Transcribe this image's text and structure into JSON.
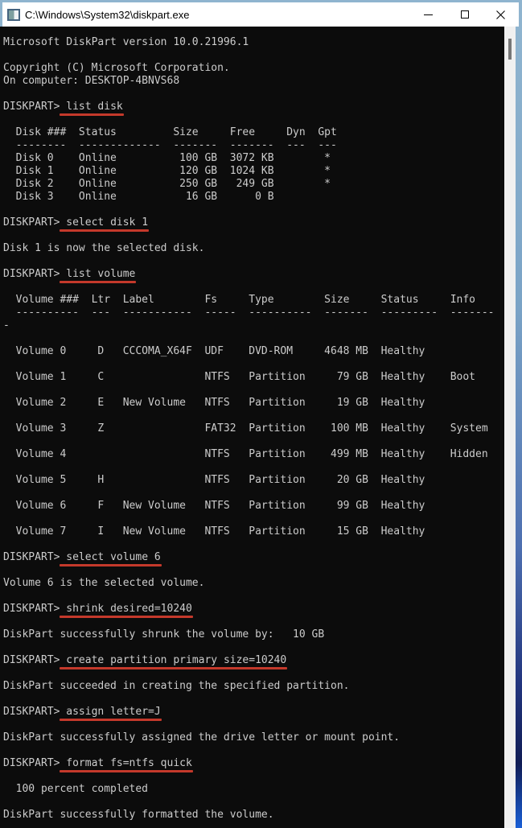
{
  "window": {
    "title": "C:\\Windows\\System32\\diskpart.exe",
    "icons": {
      "app": "console-icon",
      "minimize": "minimize-icon",
      "maximize": "maximize-icon",
      "close": "close-icon"
    },
    "close_glyph": "✕"
  },
  "colors": {
    "console_background": "#0c0c0c",
    "console_text": "#cccccc",
    "command_underline": "#c4392b",
    "titlebar_background": "#ffffff",
    "window_border": "#8fb4cf",
    "scrollbar_track": "#f0f0f0",
    "scrollbar_thumb": "#777777"
  },
  "terminal": {
    "lines": [
      {
        "text": "Microsoft DiskPart version 10.0.21996.1"
      },
      {
        "text": ""
      },
      {
        "text": "Copyright (C) Microsoft Corporation."
      },
      {
        "text": "On computer: DESKTOP-4BNVS68"
      },
      {
        "text": ""
      },
      {
        "prompt": "DISKPART> ",
        "command": "list disk"
      },
      {
        "text": ""
      },
      {
        "text": "  Disk ###  Status         Size     Free     Dyn  Gpt"
      },
      {
        "text": "  --------  -------------  -------  -------  ---  ---"
      },
      {
        "text": "  Disk 0    Online          100 GB  3072 KB        *"
      },
      {
        "text": "  Disk 1    Online          120 GB  1024 KB        *"
      },
      {
        "text": "  Disk 2    Online          250 GB   249 GB        *"
      },
      {
        "text": "  Disk 3    Online           16 GB      0 B"
      },
      {
        "text": ""
      },
      {
        "prompt": "DISKPART> ",
        "command": "select disk 1"
      },
      {
        "text": ""
      },
      {
        "text": "Disk 1 is now the selected disk."
      },
      {
        "text": ""
      },
      {
        "prompt": "DISKPART> ",
        "command": "list volume"
      },
      {
        "text": ""
      },
      {
        "text": "  Volume ###  Ltr  Label        Fs     Type        Size     Status     Info"
      },
      {
        "text": "  ----------  ---  -----------  -----  ----------  -------  ---------  -------"
      },
      {
        "text": "-"
      },
      {
        "text": ""
      },
      {
        "text": "  Volume 0     D   CCCOMA_X64F  UDF    DVD-ROM     4648 MB  Healthy"
      },
      {
        "text": ""
      },
      {
        "text": "  Volume 1     C                NTFS   Partition     79 GB  Healthy    Boot"
      },
      {
        "text": ""
      },
      {
        "text": "  Volume 2     E   New Volume   NTFS   Partition     19 GB  Healthy"
      },
      {
        "text": ""
      },
      {
        "text": "  Volume 3     Z                FAT32  Partition    100 MB  Healthy    System"
      },
      {
        "text": ""
      },
      {
        "text": "  Volume 4                      NTFS   Partition    499 MB  Healthy    Hidden"
      },
      {
        "text": ""
      },
      {
        "text": "  Volume 5     H                NTFS   Partition     20 GB  Healthy"
      },
      {
        "text": ""
      },
      {
        "text": "  Volume 6     F   New Volume   NTFS   Partition     99 GB  Healthy"
      },
      {
        "text": ""
      },
      {
        "text": "  Volume 7     I   New Volume   NTFS   Partition     15 GB  Healthy"
      },
      {
        "text": ""
      },
      {
        "prompt": "DISKPART> ",
        "command": "select volume 6"
      },
      {
        "text": ""
      },
      {
        "text": "Volume 6 is the selected volume."
      },
      {
        "text": ""
      },
      {
        "prompt": "DISKPART> ",
        "command": "shrink desired=10240"
      },
      {
        "text": ""
      },
      {
        "text": "DiskPart successfully shrunk the volume by:   10 GB"
      },
      {
        "text": ""
      },
      {
        "prompt": "DISKPART> ",
        "command": "create partition primary size=10240"
      },
      {
        "text": ""
      },
      {
        "text": "DiskPart succeeded in creating the specified partition."
      },
      {
        "text": ""
      },
      {
        "prompt": "DISKPART> ",
        "command": "assign letter=J"
      },
      {
        "text": ""
      },
      {
        "text": "DiskPart successfully assigned the drive letter or mount point."
      },
      {
        "text": ""
      },
      {
        "prompt": "DISKPART> ",
        "command": "format fs=ntfs quick"
      },
      {
        "text": ""
      },
      {
        "text": "  100 percent completed"
      },
      {
        "text": ""
      },
      {
        "text": "DiskPart successfully formatted the volume."
      }
    ]
  }
}
